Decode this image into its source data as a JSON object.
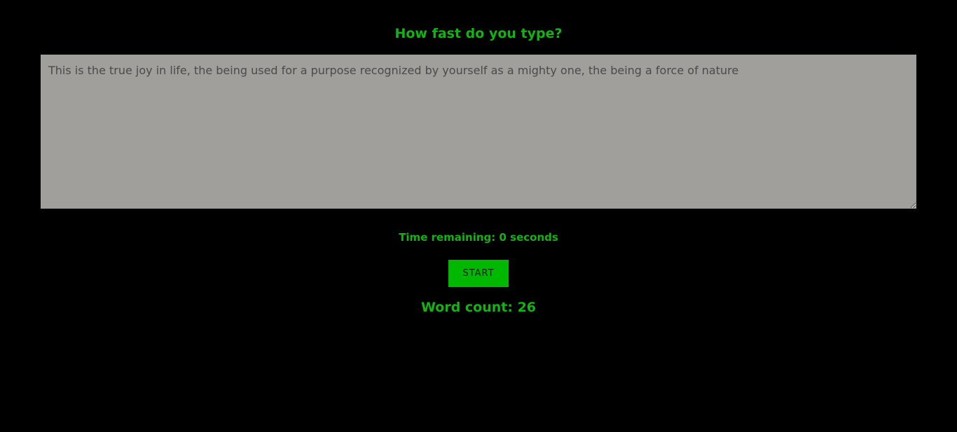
{
  "header": {
    "title": "How fast do you type?"
  },
  "editor": {
    "text": "This is the true joy in life, the being used for a purpose recognized by yourself as a mighty one, the being a force of nature"
  },
  "timer": {
    "label": "Time remaining: 0 seconds"
  },
  "controls": {
    "start_label": "START"
  },
  "stats": {
    "word_count_label": "Word count: 26"
  },
  "colors": {
    "background": "#000000",
    "accent": "#12b312",
    "button": "#00b800",
    "textarea_bg": "#a19f9c"
  }
}
